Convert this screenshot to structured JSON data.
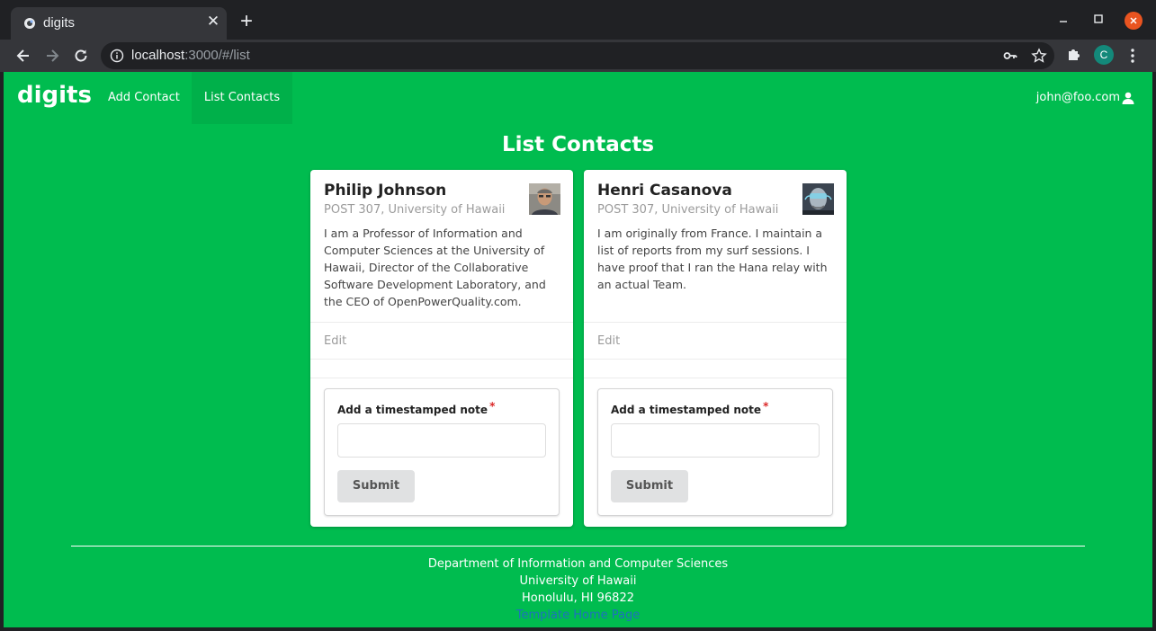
{
  "browser": {
    "tab_title": "digits",
    "tab_close": "✕",
    "new_tab": "+",
    "url_host": "localhost",
    "url_rest": ":3000/#/list",
    "profile_initial": "C"
  },
  "navbar": {
    "brand": "digits",
    "links": [
      "Add Contact",
      "List Contacts"
    ],
    "active_link": "List Contacts",
    "user": "john@foo.com"
  },
  "page": {
    "title": "List Contacts"
  },
  "contacts": [
    {
      "name": "Philip Johnson",
      "address": "POST 307, University of Hawaii",
      "description": "I am a Professor of Information and Computer Sciences at the University of Hawaii, Director of the Collaborative Software Development Laboratory, and the CEO of OpenPowerQuality.com.",
      "edit_label": "Edit",
      "note_label": "Add a timestamped note",
      "required": "*",
      "submit_label": "Submit"
    },
    {
      "name": "Henri Casanova",
      "address": "POST 307, University of Hawaii",
      "description": "I am originally from France. I maintain a list of reports from my surf sessions. I have proof that I ran the Hana relay with an actual Team.",
      "edit_label": "Edit",
      "note_label": "Add a timestamped note",
      "required": "*",
      "submit_label": "Submit"
    }
  ],
  "footer": {
    "line1": "Department of Information and Computer Sciences",
    "line2": "University of Hawaii",
    "line3": "Honolulu, HI 96822",
    "link": "Template Home Page"
  },
  "colors": {
    "page_background": "#00bc4f",
    "browser_frame": "#202124",
    "toolbar": "#35363a",
    "window_close": "#e95420",
    "link": "#1e70bf",
    "required": "#db2828"
  }
}
